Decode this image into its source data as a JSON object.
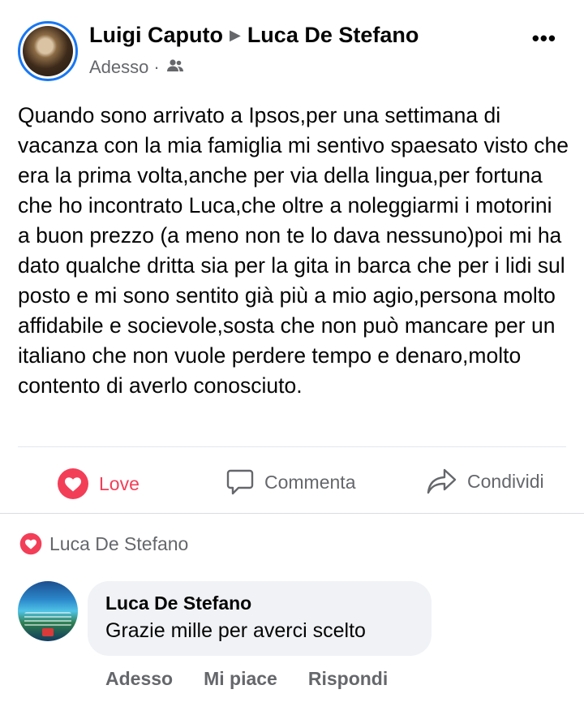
{
  "post": {
    "author": "Luigi Caputo",
    "recipient": "Luca De Stefano",
    "time": "Adesso",
    "audience_icon": "friends-icon",
    "more_label": "•••",
    "body": "Quando sono arrivato a Ipsos,per una settimana di vacanza con la mia famiglia mi sentivo spaesato visto che era la prima volta,anche per via della lingua,per fortuna che ho incontrato Luca,che oltre a noleggiarmi i motorini a buon prezzo (a meno non te lo dava nessuno)poi mi ha dato qualche dritta sia per la gita in barca che per i lidi sul posto e mi sono sentito già più a mio agio,persona molto affidabile e socievole,sosta che non può mancare per un italiano che non vuole perdere tempo e denaro,molto contento di averlo conosciuto."
  },
  "actions": {
    "love": "Love",
    "comment": "Commenta",
    "share": "Condividi"
  },
  "reaction": {
    "user": "Luca De Stefano",
    "icon": "heart-icon"
  },
  "comment": {
    "author": "Luca De Stefano",
    "text": "Grazie mille per averci scelto",
    "time": "Adesso",
    "like": "Mi piace",
    "reply": "Rispondi"
  },
  "colors": {
    "accent": "#1877f2",
    "love": "#f33e58",
    "muted": "#65676b",
    "bubble": "#f0f2f5"
  }
}
